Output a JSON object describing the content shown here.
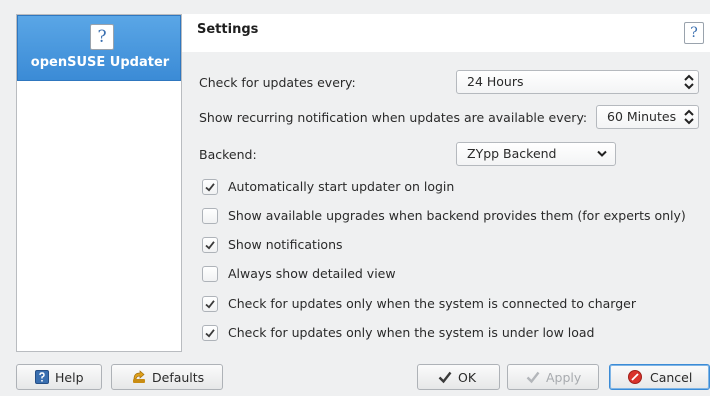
{
  "sidebar": {
    "item_label": "openSUSE Updater",
    "icon": "help-document-icon",
    "icon_glyph": "?"
  },
  "header": {
    "title": "Settings",
    "help_glyph": "?"
  },
  "form": {
    "check_interval_label": "Check for updates every:",
    "check_interval_value": "24 Hours",
    "notification_label": "Show recurring notification when updates are available every:",
    "notification_value": "60 Minutes",
    "backend_label": "Backend:",
    "backend_value": "ZYpp Backend"
  },
  "options": [
    {
      "label": "Automatically start updater on login",
      "checked": true
    },
    {
      "label": "Show available upgrades when backend provides them (for experts only)",
      "checked": false
    },
    {
      "label": "Show notifications",
      "checked": true
    },
    {
      "label": "Always show detailed view",
      "checked": false
    },
    {
      "label": "Check for updates only when the system is connected to charger",
      "checked": true
    },
    {
      "label": "Check for updates only when the system is under low load",
      "checked": true
    }
  ],
  "buttons": {
    "help": "Help",
    "defaults": "Defaults",
    "ok": "OK",
    "apply": "Apply",
    "cancel": "Cancel"
  },
  "colors": {
    "accent": "#3b8bd6",
    "window_bg": "#eff0f1",
    "cancel_icon": "#d9322b"
  }
}
